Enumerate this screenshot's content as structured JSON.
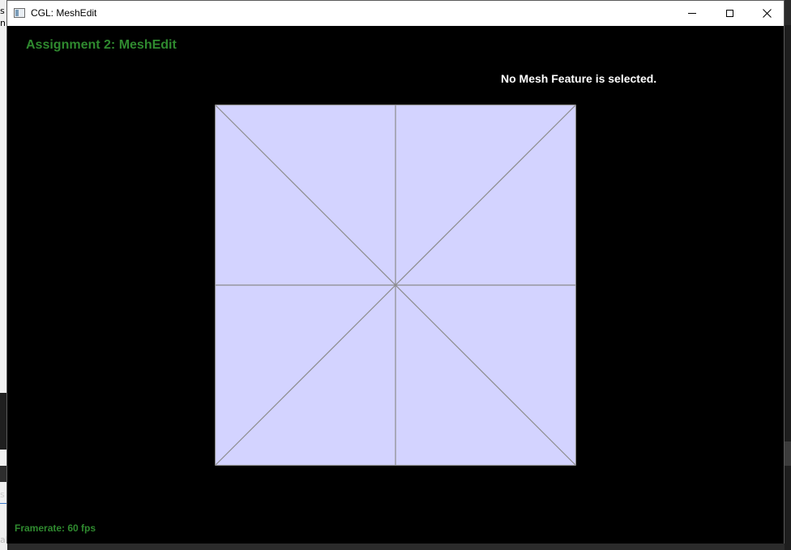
{
  "background": {
    "fragment_1": "s",
    "fragment_2": "n",
    "fragment_3": "s",
    "fragment_4": "al"
  },
  "window": {
    "title": "CGL: MeshEdit",
    "app_icon": "window-app-icon",
    "controls": {
      "minimize_icon": "minimize-icon",
      "maximize_icon": "maximize-icon",
      "close_icon": "close-icon",
      "close_glyph": "✕"
    }
  },
  "viewport": {
    "assignment_title": "Assignment 2: MeshEdit",
    "selection_status": "No Mesh Feature is selected.",
    "framerate": "Framerate: 60 fps"
  },
  "colors": {
    "viewport_bg": "#000000",
    "title_green": "#2f8a2f",
    "mesh_fill": "#d3d3ff",
    "mesh_edge": "#8c8c8c",
    "status_white": "#ffffff"
  }
}
